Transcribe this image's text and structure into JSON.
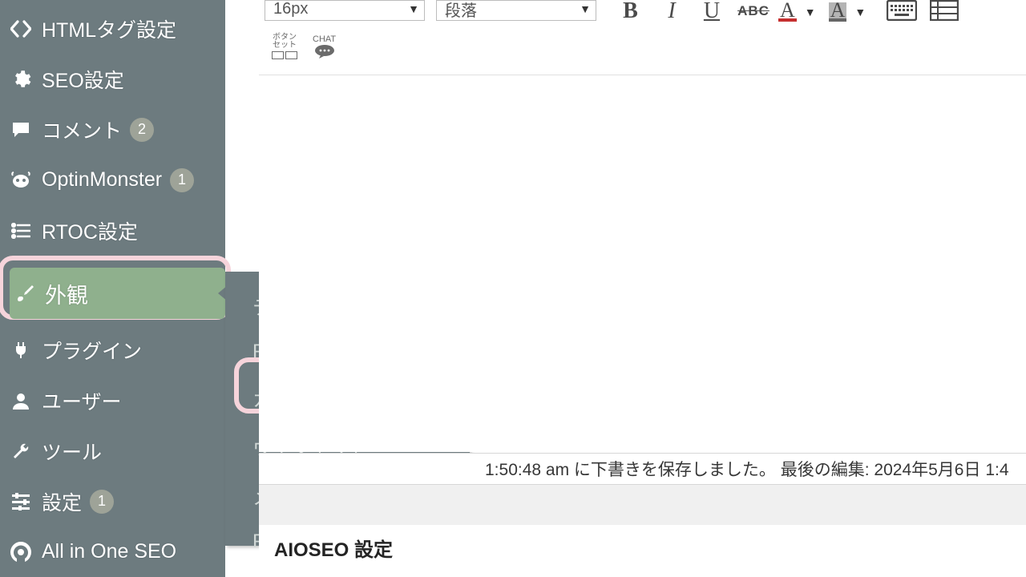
{
  "sidebar": {
    "items": [
      {
        "label": "HTMLタグ設定",
        "icon": "code"
      },
      {
        "label": "SEO設定",
        "icon": "gear"
      },
      {
        "label": "コメント",
        "icon": "comment",
        "badge": "2"
      },
      {
        "label": "OptinMonster",
        "icon": "om",
        "badge": "1"
      },
      {
        "label": "RTOC設定",
        "icon": "list"
      },
      {
        "label": "外観",
        "icon": "brush",
        "active": true
      },
      {
        "label": "プラグイン",
        "icon": "plug"
      },
      {
        "label": "ユーザー",
        "icon": "user"
      },
      {
        "label": "ツール",
        "icon": "wrench"
      },
      {
        "label": "設定",
        "icon": "sliders",
        "badge": "1"
      },
      {
        "label": "All in One SEO",
        "icon": "aioseo"
      }
    ]
  },
  "submenu": {
    "items": [
      {
        "label": "テーマ"
      },
      {
        "label": "Patterns"
      },
      {
        "label": "カスタマイズ",
        "highlight": true
      },
      {
        "label": "ウィジェット"
      },
      {
        "label": "メニュー"
      },
      {
        "label": "Popup Builder"
      }
    ]
  },
  "toolbar": {
    "font_size": "16px",
    "paragraph": "段落",
    "btnset_label": "ボタン\nセット",
    "chat_label": "CHAT",
    "text_color": "#c52f2f",
    "highlight_color": "#b4b4b4"
  },
  "status": {
    "text": "1:50:48 am に下書きを保存しました。 最後の編集: 2024年5月6日 1:4"
  },
  "aioseo_heading": "AIOSEO 設定"
}
